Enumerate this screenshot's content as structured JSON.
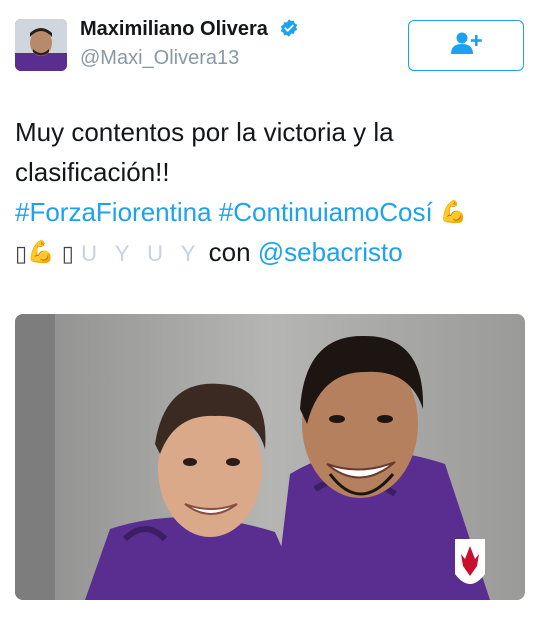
{
  "user": {
    "name": "Maximiliano Olivera",
    "handle": "@Maxi_Olivera13",
    "verified_icon": "verified-badge-icon"
  },
  "follow_button": {
    "icon": "follow-user-icon"
  },
  "tweet": {
    "line1": "Muy contentos por la victoria y la",
    "line2": "clasificación!!",
    "hashtag1": "#ForzaFiorentina",
    "hashtag2": "#ContinuiamoCosí",
    "emoji_flex": "💪",
    "box_glyph": "▯",
    "faint_flags": "U  Y  U  Y",
    "con_text": "con",
    "mention": "@sebacristo"
  },
  "colors": {
    "link": "#1da1f2",
    "secondary_text": "#8899a6",
    "kit_purple": "#5a2d91"
  }
}
